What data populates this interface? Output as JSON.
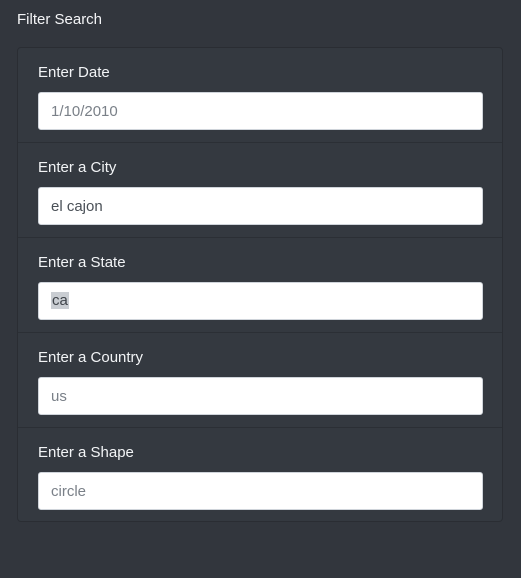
{
  "panel": {
    "title": "Filter Search"
  },
  "fields": {
    "date": {
      "label": "Enter Date",
      "placeholder": "1/10/2010",
      "value": ""
    },
    "city": {
      "label": "Enter a City",
      "placeholder": "",
      "value": "el cajon"
    },
    "state": {
      "label": "Enter a State",
      "placeholder": "",
      "value": "ca",
      "selected": true
    },
    "country": {
      "label": "Enter a Country",
      "placeholder": "us",
      "value": ""
    },
    "shape": {
      "label": "Enter a Shape",
      "placeholder": "circle",
      "value": ""
    }
  }
}
